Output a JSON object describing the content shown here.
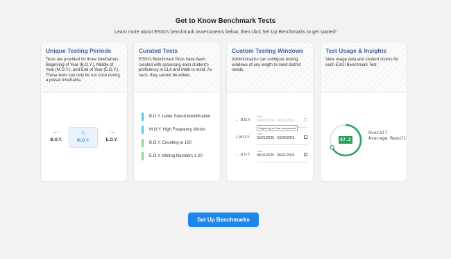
{
  "header": {
    "title": "Get to Know Benchmark Tests",
    "subtitle": "Learn more about ESGI's benchmark assessments below, then click Set Up Benchmarks to get started!"
  },
  "cards": [
    {
      "title": "Unique Testing Periods",
      "description": "Tests are provided for three timeframes: Beginning of Year (B.O.Y.), Middle of Year (M.O.Y.), and End of Year (E.O.Y.). These tests can only be run once during a preset timeframe.",
      "periods": [
        {
          "label": "B.O.Y.",
          "arrow": "←·"
        },
        {
          "label": "M.O.Y.",
          "arrow": "·|·"
        },
        {
          "label": "E.O.Y.",
          "arrow": "·→"
        }
      ],
      "active_period": "M.O.Y."
    },
    {
      "title": "Curated Tests",
      "description": "ESGI's Benchmark Tests have been created with assessing each student's proficiency in ELA and Math in mind. As such, they cannot be edited.",
      "tests": [
        {
          "label": "B.O.Y. Letter Sound Identification",
          "color": "#5bc0eb"
        },
        {
          "label": "M.O.Y. High Frequency Words",
          "color": "#5bc0eb"
        },
        {
          "label": "B.O.Y. Counting to 100",
          "color": "#8fd694"
        },
        {
          "label": "E.O.Y. Writing Numbers 1-20",
          "color": "#8fd694"
        }
      ]
    },
    {
      "title": "Custom Testing Windows",
      "description": "Administrators can configure testing windows of any length to meet district needs.",
      "windows": [
        {
          "label": "B.O.Y.",
          "arrow": "←·",
          "field_label": "Date",
          "value": "06/01/2024 - 08/31/2024",
          "disabled": true
        },
        {
          "label": "M.O.Y.",
          "arrow": "·|·",
          "field_label": "Date",
          "value": "03/01/2025 - 03/22/2025",
          "disabled": false
        },
        {
          "label": "E.O.Y.",
          "arrow": "·→",
          "field_label": "Date",
          "value": "05/01/2025 - 05/31/2025",
          "disabled": false
        }
      ],
      "tooltip": "Beginning of Year has passed"
    },
    {
      "title": "Test Usage & Insights",
      "description": "View usage data and student scores for each ESGI Benchmark Test.",
      "score": "67.2",
      "score_fraction": 0.672,
      "score_caption_1": "Overall",
      "score_caption_2": "Average Result",
      "accent": "#29a05b"
    }
  ],
  "button": {
    "label": "Set Up Benchmarks",
    "color": "#1f86e8"
  }
}
